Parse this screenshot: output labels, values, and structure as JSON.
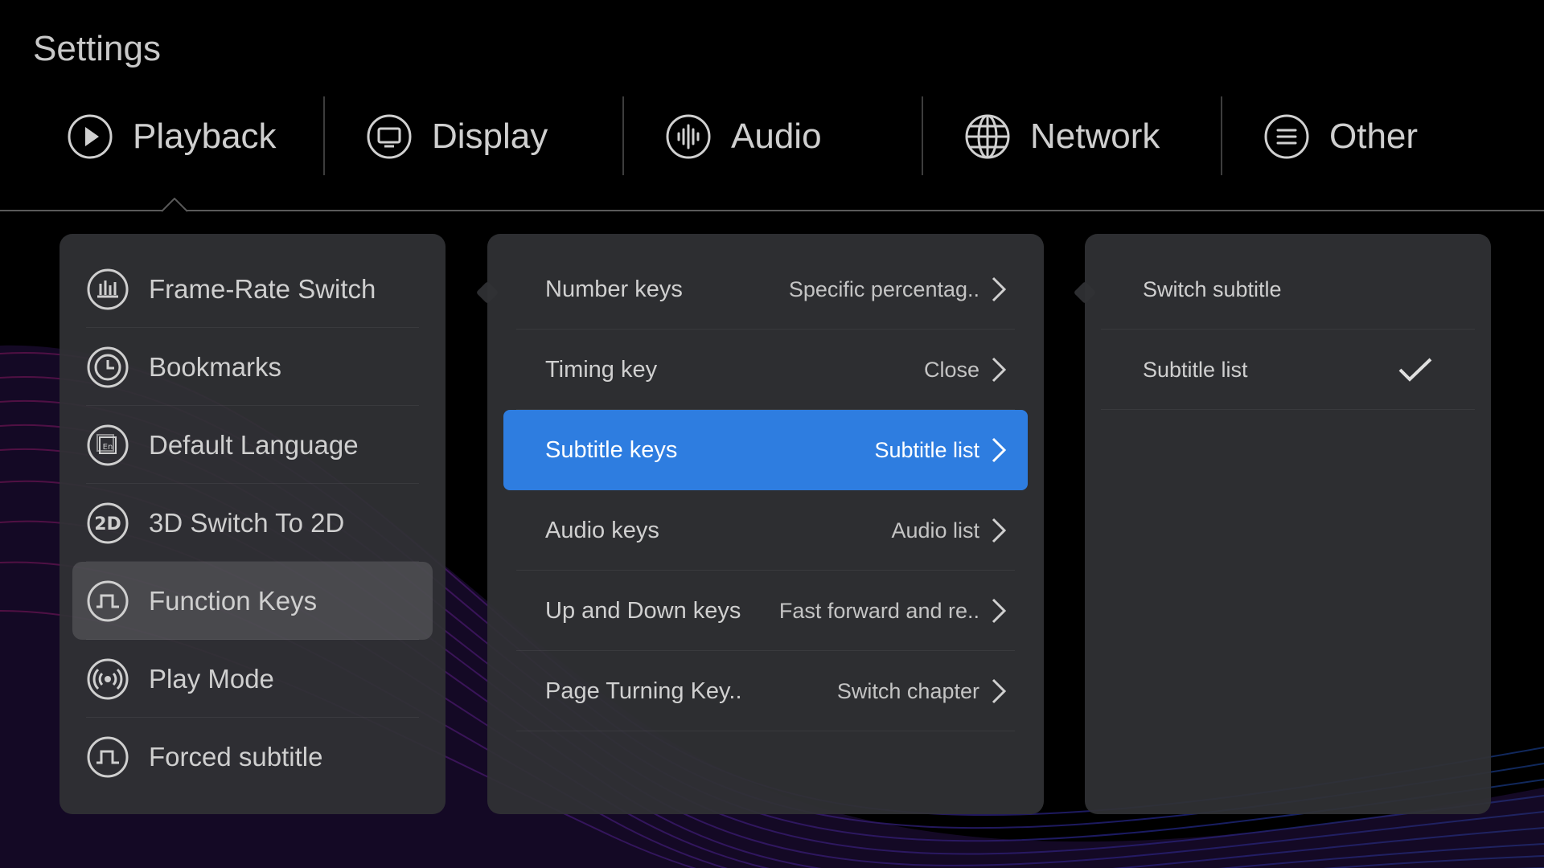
{
  "screen_title": "Settings",
  "tabs": [
    {
      "label": "Playback",
      "icon": "play-circle-icon"
    },
    {
      "label": "Display",
      "icon": "monitor-icon"
    },
    {
      "label": "Audio",
      "icon": "audio-wave-icon"
    },
    {
      "label": "Network",
      "icon": "globe-icon"
    },
    {
      "label": "Other",
      "icon": "menu-lines-icon"
    }
  ],
  "active_tab": "Playback",
  "playback_menu": [
    {
      "label": "Frame-Rate Switch",
      "icon": "bar-chart-icon"
    },
    {
      "label": "Bookmarks",
      "icon": "clock-icon"
    },
    {
      "label": "Default Language",
      "icon": "language-en-icon"
    },
    {
      "label": "3D Switch To 2D",
      "icon": "2d-badge-icon"
    },
    {
      "label": "Function Keys",
      "icon": "pulse-wave-icon",
      "active": true
    },
    {
      "label": "Play Mode",
      "icon": "broadcast-icon"
    },
    {
      "label": "Forced subtitle",
      "icon": "pulse-wave-icon"
    }
  ],
  "function_keys": [
    {
      "label": "Number keys",
      "value": "Specific percentag.."
    },
    {
      "label": "Timing key",
      "value": "Close"
    },
    {
      "label": "Subtitle keys",
      "value": "Subtitle list",
      "selected": true
    },
    {
      "label": "Audio keys",
      "value": "Audio list"
    },
    {
      "label": "Up and Down keys",
      "value": "Fast forward and re.."
    },
    {
      "label": "Page Turning Key..",
      "value": "Switch chapter"
    }
  ],
  "subtitle_options": [
    {
      "label": "Switch subtitle",
      "checked": false
    },
    {
      "label": "Subtitle list",
      "checked": true
    }
  ],
  "colors": {
    "background": "#000000",
    "panel": "#303135",
    "highlight": "#2e7de0",
    "text": "#cfcfcf"
  }
}
